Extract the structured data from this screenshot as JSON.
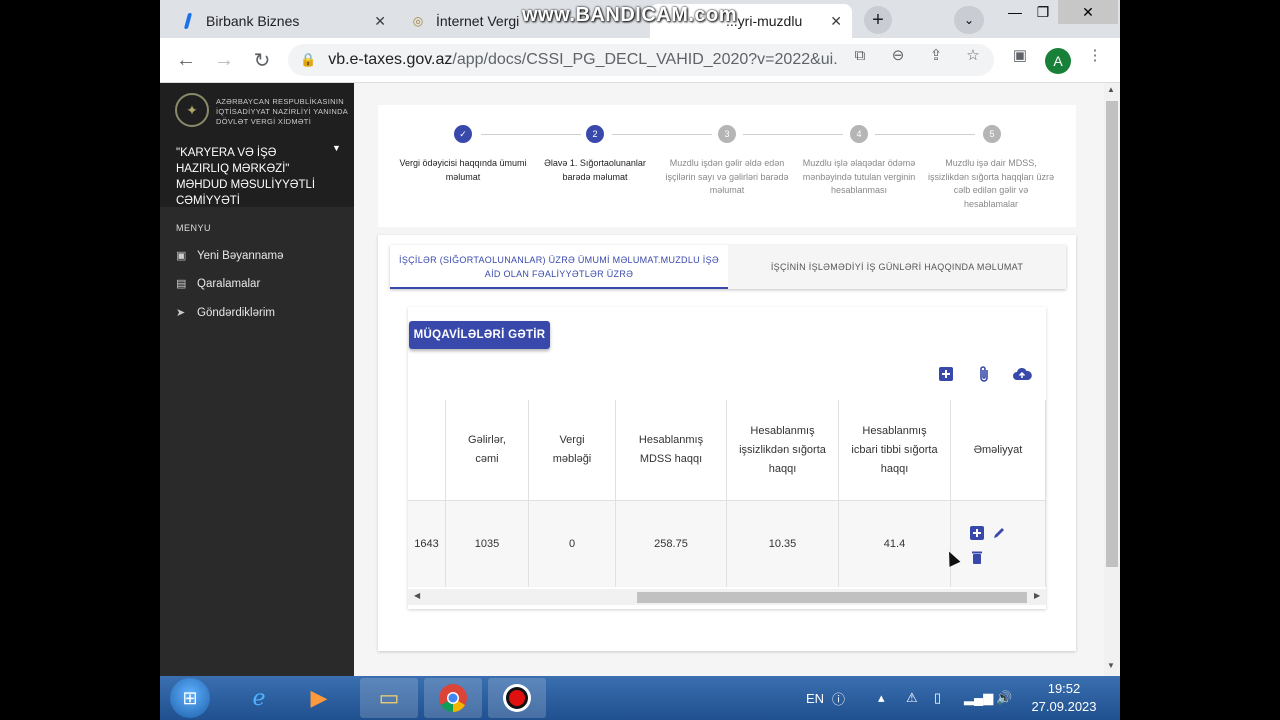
{
  "browser": {
    "tabs": [
      {
        "title": "Birbank Biznes",
        "active": false
      },
      {
        "title": "İnternet Vergi",
        "active": false
      },
      {
        "title": "...yri-muzdlu",
        "active": true
      }
    ],
    "watermark": "www.BANDICAM.com",
    "url_host": "vb.e-taxes.gov.az",
    "url_path": "/app/docs/CSSI_PG_DECL_VAHID_2020?v=2022&ui...",
    "profile_initial": "A",
    "profile_color": "#188038"
  },
  "sidebar": {
    "org_line1": "AZƏRBAYCAN RESPUBLİKASININ",
    "org_line2": "İQTİSADİYYAT NAZİRLİYİ YANINDA",
    "org_line3": "DÖVLƏT VERGİ XİDMƏTİ",
    "company": "\"KARYERA VƏ İŞƏ HAZIRLIQ MƏRKƏZİ\" MƏHDUD MƏSULİYYƏTLİ CƏMİYYƏTİ",
    "menu_title": "MENYU",
    "items": [
      {
        "label": "Yeni Bəyannamə",
        "icon": "new-document-icon"
      },
      {
        "label": "Qaralamalar",
        "icon": "draft-icon"
      },
      {
        "label": "Göndərdiklərim",
        "icon": "send-icon"
      }
    ]
  },
  "stepper": {
    "accent": "#3949ab",
    "steps": [
      {
        "number": "1",
        "status": "done",
        "label": "Vergi ödəyicisi haqqında ümumi məlumat"
      },
      {
        "number": "2",
        "status": "active",
        "label": "Əlavə 1. Sığortaolunanlar barədə məlumat"
      },
      {
        "number": "3",
        "status": "pending",
        "label": "Muzdlu işdən gəlir əldə edən işçilərin sayı və gəlirləri barədə məlumat"
      },
      {
        "number": "4",
        "status": "pending",
        "label": "Muzdlu işlə əlaqədar ödəmə mənbəyində tutulan verginin hesablanması"
      },
      {
        "number": "5",
        "status": "pending",
        "label": "Muzdlu işə dair MDSS, işsizlikdən sığorta haqqları üzrə cəlb edilən gəlir və hesablamalar"
      }
    ]
  },
  "tabs": {
    "tab1": "İŞÇİLƏR (SIĞORTAOLUNANLAR) ÜZRƏ ÜMUMİ MƏLUMAT.MUZDLU İŞƏ AİD OLAN FƏALİYYƏTLƏR ÜZRƏ",
    "tab2": "İŞÇİNİN İŞLƏMƏDİYİ İŞ GÜNLƏRİ HAQQINDA MƏLUMAT"
  },
  "fetch_button": "MÜQAVİLƏLƏRİ GƏTİR",
  "table": {
    "headers": [
      "",
      "Gəlirlər, cəmi",
      "Vergi məbləği",
      "Hesablanmış MDSS haqqı",
      "Hesablanmış işsizlikdən sığorta haqqı",
      "Hesablanmış icbari tibbi sığorta haqqı",
      "Əməliyyat"
    ],
    "rows": [
      {
        "cells": [
          "1643",
          "1035",
          "0",
          "258.75",
          "10.35",
          "41.4",
          ""
        ]
      }
    ]
  },
  "taskbar": {
    "language": "EN",
    "time": "19:52",
    "date": "27.09.2023"
  }
}
